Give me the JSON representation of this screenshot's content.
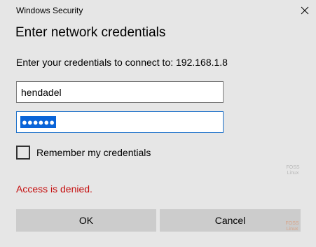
{
  "window": {
    "title": "Windows Security",
    "close_glyph": "×"
  },
  "dialog": {
    "heading": "Enter network credentials",
    "prompt": "Enter your credentials to connect to: 192.168.1.8"
  },
  "form": {
    "username_value": "hendadel",
    "password_mask": "●●●●●●",
    "remember_label": "Remember my credentials",
    "remember_checked": false
  },
  "status": {
    "error_text": "Access is denied.",
    "error_color": "#c50f0f"
  },
  "buttons": {
    "ok_label": "OK",
    "cancel_label": "Cancel"
  },
  "watermark": {
    "line1": "FOSS",
    "line2": "Linux"
  },
  "colors": {
    "background": "#e6e6e6",
    "focus_border": "#1a6fc9",
    "selection": "#0a64d8",
    "button": "#cccccc"
  }
}
